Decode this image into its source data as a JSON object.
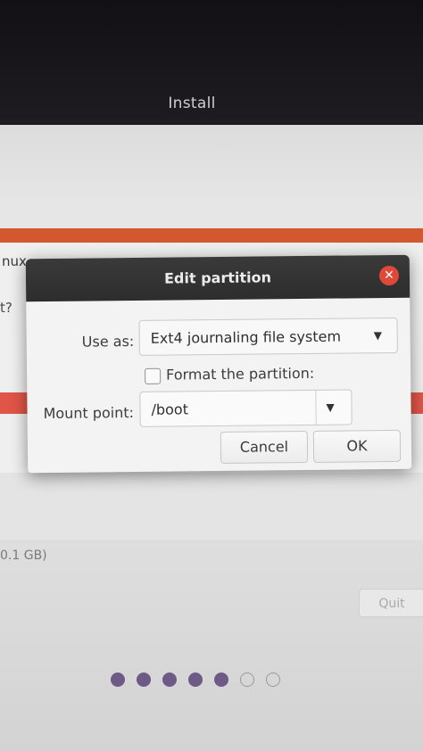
{
  "window": {
    "title": "Install"
  },
  "background": {
    "partial_linux": "nux",
    "partial_question": "t?",
    "partial_size": "0.1 GB)",
    "quit_label": "Quit"
  },
  "progress": {
    "total_steps": 7,
    "completed_steps": 5
  },
  "dialog": {
    "title": "Edit partition",
    "close_icon": "close-icon",
    "use_as_label": "Use as:",
    "use_as_value": "Ext4 journaling file system",
    "format_label": "Format the partition:",
    "format_checked": false,
    "mount_point_label": "Mount point:",
    "mount_point_value": "/boot",
    "cancel_label": "Cancel",
    "ok_label": "OK"
  },
  "colors": {
    "accent_orange": "#d2582f",
    "close_red": "#e0493a",
    "dot_purple": "#6e5a86",
    "error_red": "#e05547"
  }
}
